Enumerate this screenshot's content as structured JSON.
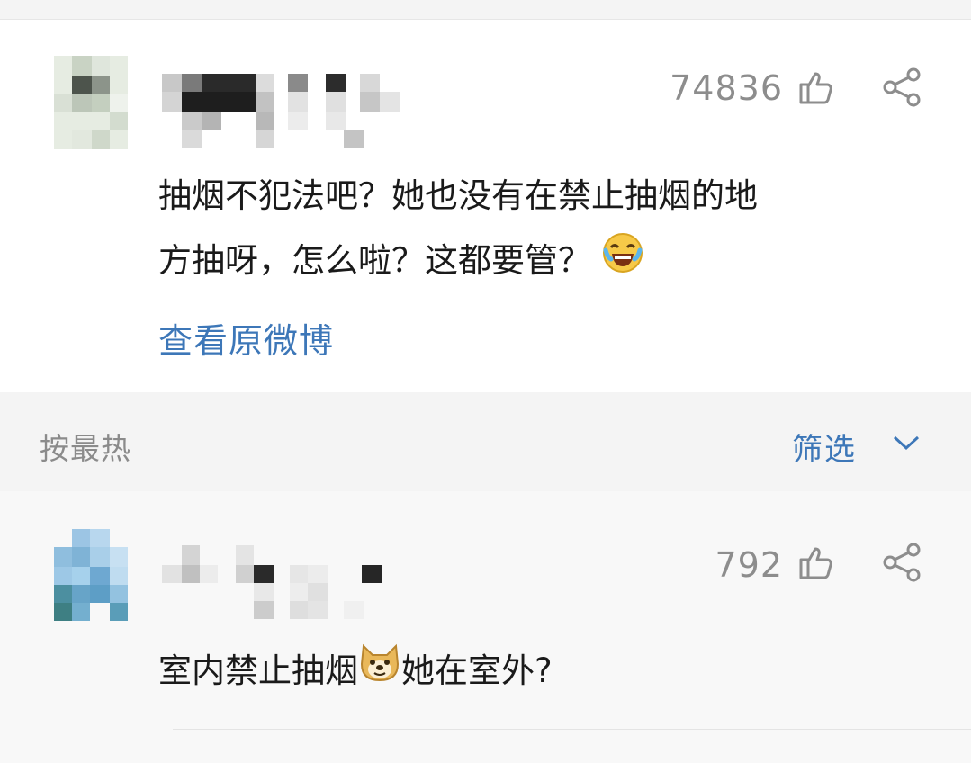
{
  "post": {
    "like_count": "74836",
    "text_line1": "抽烟不犯法吧？她也没有在禁止抽烟的地",
    "text_line2": "方抽呀，怎么啦？这都要管？",
    "emoji": "laugh-cry-icon",
    "view_original": "查看原微博"
  },
  "toolbar": {
    "sort_label": "按最热",
    "filter_label": "筛选"
  },
  "comment": {
    "like_count": "792",
    "text_before_emoji": "室内禁止抽烟",
    "emoji": "doge-icon",
    "text_after_emoji": "她在室外?"
  },
  "colors": {
    "link": "#3d77b8",
    "muted": "#8d8d8d",
    "text": "#1a1a1a"
  }
}
